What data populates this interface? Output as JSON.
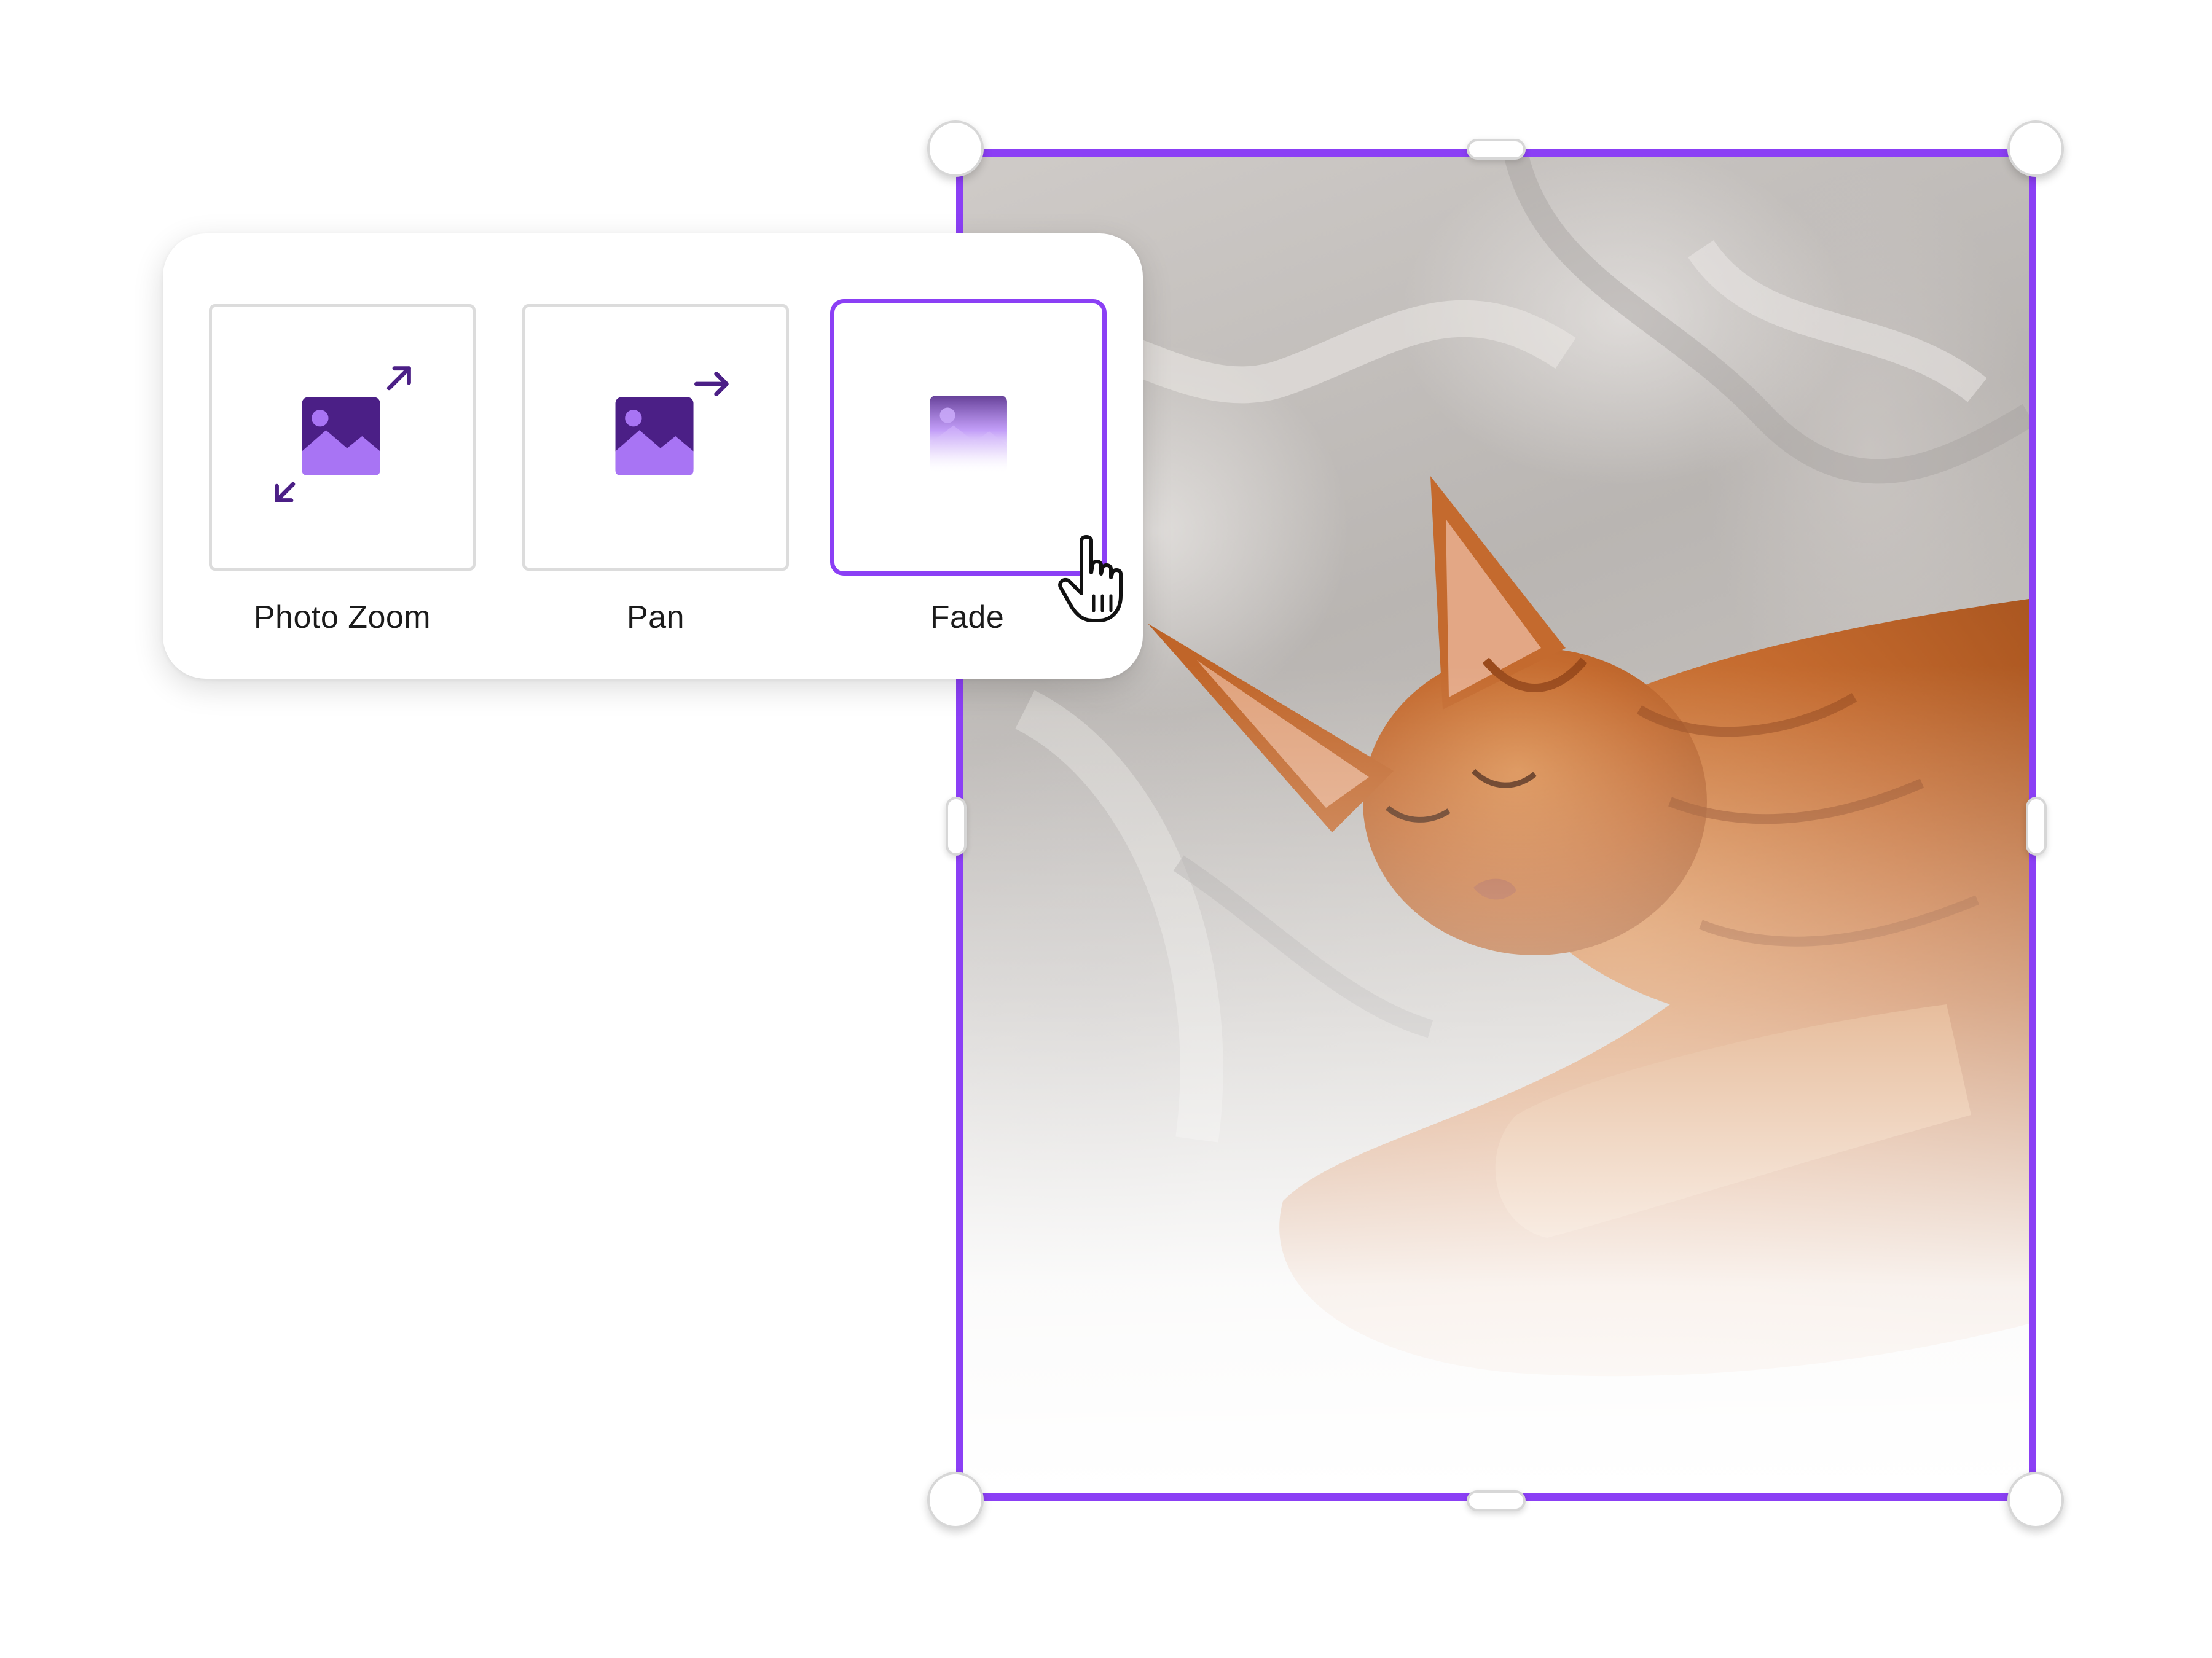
{
  "animations": {
    "items": [
      {
        "label": "Photo Zoom",
        "icon": "photo-zoom-icon"
      },
      {
        "label": "Pan",
        "icon": "photo-pan-icon"
      },
      {
        "label": "Fade",
        "icon": "photo-fade-icon",
        "selected": true
      }
    ]
  },
  "colors": {
    "accent": "#8b3ff5",
    "icon_dark": "#4b1f86",
    "icon_light": "#a874f4"
  }
}
